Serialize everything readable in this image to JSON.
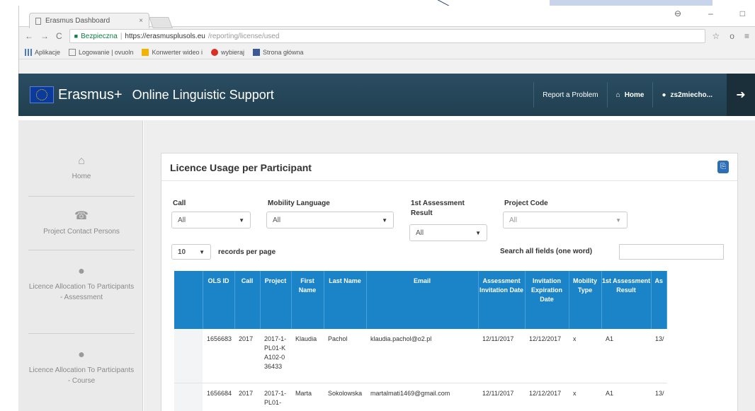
{
  "browser": {
    "tab_title": "Erasmus Dashboard",
    "secure_label": "Bezpieczna",
    "url_domain": "https://erasmusplusols.eu",
    "url_path": "/reporting/license/used",
    "bookmarks": [
      "Aplikacje",
      "Logowanie | ovuoln",
      "Konwerter wideo i",
      "wybieraj",
      "Strona główna"
    ]
  },
  "header": {
    "brand": "Erasmus+",
    "subtitle": "Online Linguistic Support",
    "report_problem": "Report a Problem",
    "home": "Home",
    "user": "zs2miecho..."
  },
  "sidebar": {
    "items": [
      {
        "label": "Home",
        "icon": "home-icon"
      },
      {
        "label": "Project Contact Persons",
        "icon": "phone-icon"
      },
      {
        "label": "Licence Allocation To Participants - Assessment",
        "icon": "pin-icon"
      },
      {
        "label": "Licence Allocation To Participants - Course",
        "icon": "pin-icon"
      }
    ]
  },
  "panel": {
    "title": "Licence Usage per Participant",
    "filters": {
      "call_label": "Call",
      "call_value": "All",
      "mobility_label": "Mobility Language",
      "mobility_value": "All",
      "assessment_label": "1st Assessment Result",
      "assessment_value": "All",
      "project_label": "Project Code",
      "project_value": "All"
    },
    "records_per_page": "10",
    "records_label": "records per page",
    "search_label": "Search all fields (one word)",
    "search_value": ""
  },
  "table": {
    "headers": [
      "",
      "OLS ID",
      "Call",
      "Project",
      "First Name",
      "Last Name",
      "Email",
      "Assessment Invitation Date",
      "Invitation Expiration Date",
      "Mobility Type",
      "1st Assessment Result",
      "As"
    ],
    "rows": [
      [
        "",
        "1656683",
        "2017",
        "2017-1-PL01-KA102-036433",
        "Klaudia",
        "Pachol",
        "klaudia.pachol@o2.pl",
        "12/11/2017",
        "12/12/2017",
        "x",
        "A1",
        "13/"
      ],
      [
        "",
        "1656684",
        "2017",
        "2017-1-PL01-",
        "Marta",
        "Sokolowska",
        "martalmati1469@gmail.com",
        "12/11/2017",
        "12/12/2017",
        "x",
        "A1",
        "13/"
      ]
    ]
  },
  "colors": {
    "header_bg": "#2b4d63",
    "table_header": "#1b84c9",
    "sidebar_bg": "#eaeaea"
  }
}
